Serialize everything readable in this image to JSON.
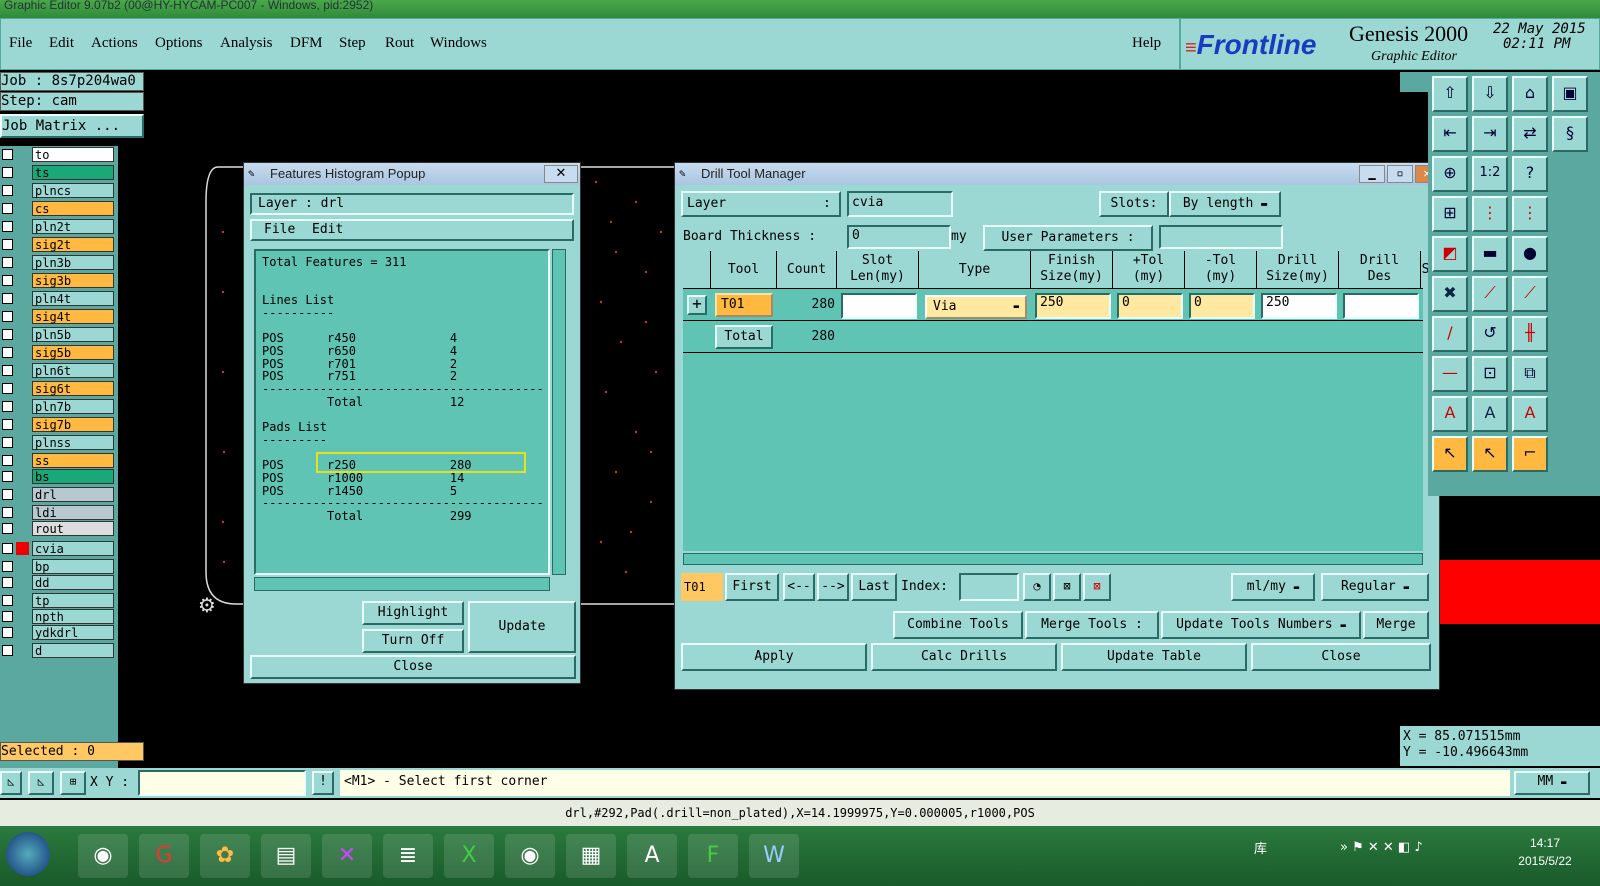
{
  "window_title": "Graphic Editor 9.07b2 (00@HY-HYCAM-PC007 - Windows, pid:2952)",
  "menu": [
    "File",
    "Edit",
    "Actions",
    "Options",
    "Analysis",
    "DFM",
    "Step",
    "Rout",
    "Windows"
  ],
  "help": "Help",
  "brand": {
    "logo": "Frontline",
    "product": "Genesis 2000",
    "subtitle": "Graphic Editor",
    "date": "22 May 2015",
    "time": "02:11 PM"
  },
  "job": {
    "job": "Job : 8s7p204wa0",
    "step": "Step: cam",
    "matrix": "Job Matrix ..."
  },
  "layers": [
    {
      "name": "to",
      "color": "#ffffff"
    },
    {
      "name": "ts",
      "color": "#1aa878"
    },
    {
      "name": "plncs",
      "color": "#9cd8d3"
    },
    {
      "name": "cs",
      "color": "#ffb840"
    },
    {
      "name": "pln2t",
      "color": "#9cd8d3"
    },
    {
      "name": "sig2t",
      "color": "#ffb840"
    },
    {
      "name": "pln3b",
      "color": "#9cd8d3"
    },
    {
      "name": "sig3b",
      "color": "#ffb840"
    },
    {
      "name": "pln4t",
      "color": "#9cd8d3"
    },
    {
      "name": "sig4t",
      "color": "#ffb840"
    },
    {
      "name": "pln5b",
      "color": "#9cd8d3"
    },
    {
      "name": "sig5b",
      "color": "#ffb840"
    },
    {
      "name": "pln6t",
      "color": "#9cd8d3"
    },
    {
      "name": "sig6t",
      "color": "#ffb840"
    },
    {
      "name": "pln7b",
      "color": "#9cd8d3"
    },
    {
      "name": "sig7b",
      "color": "#ffb840"
    },
    {
      "name": "plnss",
      "color": "#9cd8d3"
    },
    {
      "name": "ss",
      "color": "#ffb840"
    },
    {
      "name": "bs",
      "color": "#1aa878"
    },
    {
      "name": "drl",
      "color": "#b8c8d0"
    },
    {
      "name": "ldi",
      "color": "#b8c8d0"
    },
    {
      "name": "rout",
      "color": "#dddddd"
    },
    {
      "name": "cvia",
      "color": "#9cd8d3"
    },
    {
      "name": "bp",
      "color": "#9cd8d3"
    },
    {
      "name": "dd",
      "color": "#9cd8d3"
    },
    {
      "name": "tp",
      "color": "#9cd8d3"
    },
    {
      "name": "npth",
      "color": "#9cd8d3"
    },
    {
      "name": "ydkdrl",
      "color": "#9cd8d3"
    },
    {
      "name": "d",
      "color": "#9cd8d3"
    }
  ],
  "selected": "Selected : 0",
  "histogram": {
    "title": "Features Histogram Popup",
    "layer_label": "Layer :  drl",
    "menu": [
      "File",
      "Edit"
    ],
    "lines": [
      "Total Features = 311",
      "",
      "",
      "Lines List",
      "----------",
      "",
      "POS      r450             4",
      "POS      r650             4",
      "POS      r701             2",
      "POS      r751             2",
      "---------------------------------------",
      "         Total            12",
      "",
      "Pads List",
      "---------",
      "",
      "POS      r250             280",
      "POS      r1000            14",
      "POS      r1450            5",
      "---------------------------------------",
      "         Total            299"
    ],
    "highlight": "Highlight",
    "turnoff": "Turn Off",
    "update": "Update",
    "close": "Close"
  },
  "drill": {
    "title": "Drill Tool Manager",
    "layer_label": "Layer",
    "layer_value": "cvia",
    "slots_label": "Slots:",
    "slots_value": "By length",
    "board_label": "Board Thickness :",
    "board_value": "0",
    "board_unit": "my",
    "userparams": "User Parameters :",
    "headers": [
      "Tool",
      "Count",
      "Slot\nLen(my)",
      "Type",
      "Finish\nSize(my)",
      "+Tol\n(my)",
      "-Tol\n(my)",
      "Drill\nSize(my)",
      "Drill\nDes",
      "S"
    ],
    "row": {
      "tool": "T01",
      "count": "280",
      "slot": "",
      "type": "Via",
      "finish": "250",
      "ptol": "0",
      "mtol": "0",
      "drill": "250",
      "des": ""
    },
    "total": {
      "label": "Total",
      "count": "280"
    },
    "nav": {
      "current": "T01",
      "first": "First",
      "prev": "<--",
      "next": "-->",
      "last": "Last",
      "index": "Index:",
      "units": "ml/my",
      "mode": "Regular"
    },
    "combine": "Combine Tools",
    "merge_tools": "Merge Tools :",
    "update_numbers": "Update Tools Numbers",
    "merge": "Merge",
    "apply": "Apply",
    "calc": "Calc Drills",
    "update_table": "Update Table",
    "close": "Close"
  },
  "coords": {
    "x": "X = 85.071515mm",
    "y": "Y = -10.496643mm"
  },
  "command": {
    "xy_label": "X Y :",
    "prompt": "<M1> - Select first corner",
    "units": "MM"
  },
  "status": "drl,#292,Pad(.drill=non_plated),X=14.1999975,Y=0.000005,r1000,POS",
  "clock": {
    "time": "14:17",
    "date": "2015/5/22"
  },
  "tray_label": "库"
}
